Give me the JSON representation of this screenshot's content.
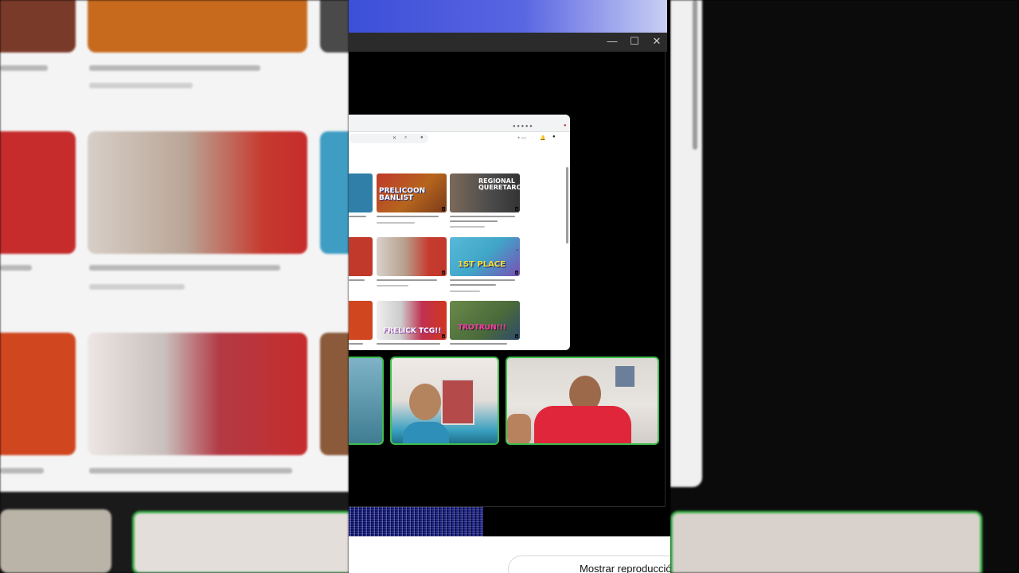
{
  "window_controls": {
    "minimize": "—",
    "maximize": "☐",
    "close": "✕"
  },
  "browser": {
    "thumbnails": [
      {
        "overlay_text": "PRELICOON BANLIST",
        "bg": "#b5651d"
      },
      {
        "overlay_text": "REGIONAL QUERETARO",
        "bg": "#6a6a6a"
      },
      {
        "overlay_text": "",
        "bg": "#c0392b"
      },
      {
        "overlay_text": "1ST PLACE",
        "bg": "#3fa6c8"
      },
      {
        "overlay_text": "FRELICK TCG!!",
        "bg": "#c0392b"
      },
      {
        "overlay_text": "TROTRUN!!!",
        "bg": "#4a6a3a"
      }
    ]
  },
  "cta": {
    "label": "Mostrar reproducción"
  },
  "colors": {
    "cam_border": "#3fbf4f",
    "desktop_accent": "#3c4fd8"
  }
}
